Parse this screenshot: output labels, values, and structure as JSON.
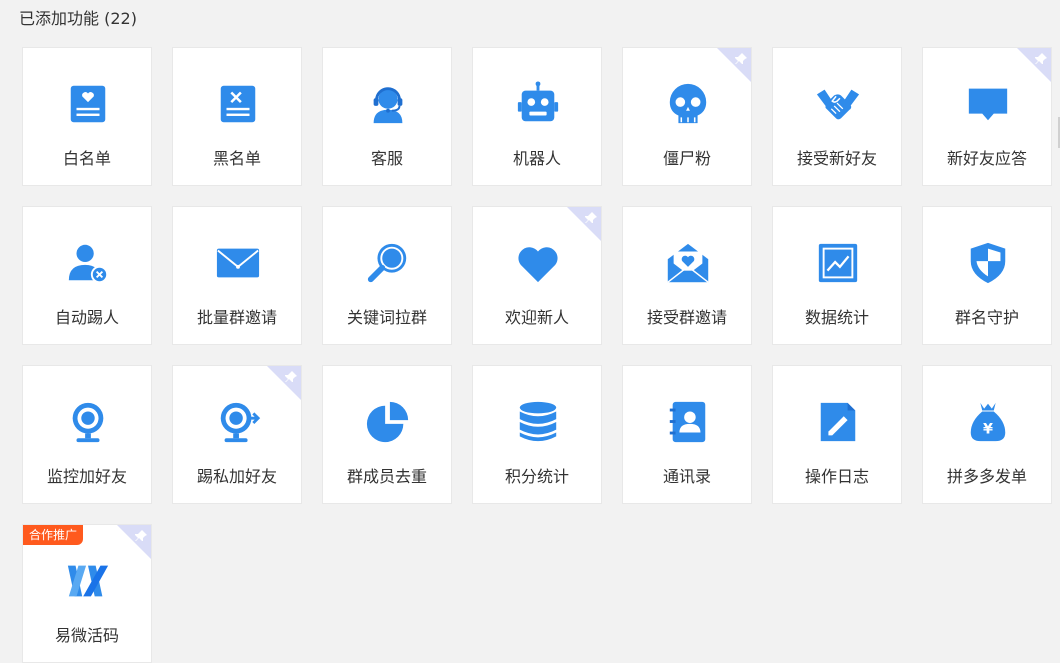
{
  "section": {
    "title": "已添加功能 (22)"
  },
  "colors": {
    "accent": "#2f8bea",
    "pin_corner": "#d9dcf7",
    "promo_badge": "#ff5a1e"
  },
  "features": [
    {
      "label": "白名单",
      "icon": "whitelist-icon",
      "pinned": false
    },
    {
      "label": "黑名单",
      "icon": "blacklist-icon",
      "pinned": false
    },
    {
      "label": "客服",
      "icon": "customer-service-icon",
      "pinned": false
    },
    {
      "label": "机器人",
      "icon": "robot-icon",
      "pinned": false
    },
    {
      "label": "僵尸粉",
      "icon": "zombie-skull-icon",
      "pinned": true
    },
    {
      "label": "接受新好友",
      "icon": "handshake-icon",
      "pinned": false
    },
    {
      "label": "新好友应答",
      "icon": "chat-bubble-icon",
      "pinned": true
    },
    {
      "label": "自动踢人",
      "icon": "user-remove-icon",
      "pinned": false
    },
    {
      "label": "批量群邀请",
      "icon": "envelope-icon",
      "pinned": false
    },
    {
      "label": "关键词拉群",
      "icon": "magnifier-icon",
      "pinned": false
    },
    {
      "label": "欢迎新人",
      "icon": "heart-icon",
      "pinned": true
    },
    {
      "label": "接受群邀请",
      "icon": "open-envelope-heart-icon",
      "pinned": false
    },
    {
      "label": "数据统计",
      "icon": "line-chart-icon",
      "pinned": false
    },
    {
      "label": "群名守护",
      "icon": "shield-icon",
      "pinned": false
    },
    {
      "label": "监控加好友",
      "icon": "webcam-icon",
      "pinned": false
    },
    {
      "label": "踢私加好友",
      "icon": "webcam-arrow-icon",
      "pinned": true
    },
    {
      "label": "群成员去重",
      "icon": "pie-chart-icon",
      "pinned": false
    },
    {
      "label": "积分统计",
      "icon": "database-icon",
      "pinned": false
    },
    {
      "label": "通讯录",
      "icon": "contact-book-icon",
      "pinned": false
    },
    {
      "label": "操作日志",
      "icon": "edit-document-icon",
      "pinned": false
    },
    {
      "label": "拼多多发单",
      "icon": "money-bag-icon",
      "pinned": false
    },
    {
      "label": "易微活码",
      "icon": "yiwei-logo-icon",
      "pinned": true,
      "badge": "合作推广"
    }
  ]
}
